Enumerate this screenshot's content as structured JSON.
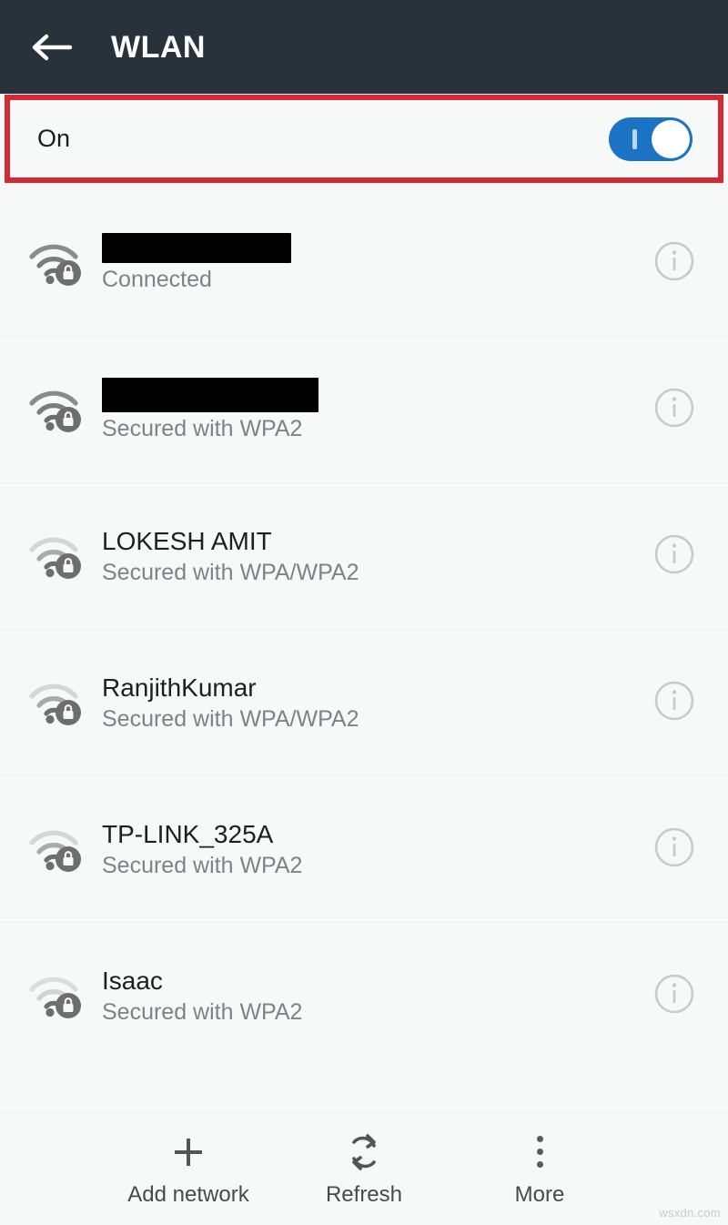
{
  "header": {
    "title": "WLAN",
    "back_icon": "arrow-left-icon",
    "background_color": "#28323a"
  },
  "wifi_switch_row": {
    "label": "On",
    "enabled": true,
    "highlight_color": "#d42a36",
    "toggle_color": "#1a73c4"
  },
  "networks": [
    {
      "ssid": "",
      "redacted": true,
      "redact_width": "w1",
      "status": "Connected",
      "icon": "wifi-lock-icon",
      "signal": 3,
      "info_icon": "info-circle-icon"
    },
    {
      "ssid": "",
      "redacted": true,
      "redact_width": "w2",
      "status": "Secured with WPA2",
      "icon": "wifi-lock-icon",
      "signal": 3,
      "info_icon": "info-circle-icon"
    },
    {
      "ssid": "LOKESH AMIT",
      "redacted": false,
      "redact_width": "",
      "status": "Secured with WPA/WPA2",
      "icon": "wifi-lock-icon",
      "signal": 2,
      "info_icon": "info-circle-icon"
    },
    {
      "ssid": "RanjithKumar",
      "redacted": false,
      "redact_width": "",
      "status": "Secured with WPA/WPA2",
      "icon": "wifi-lock-icon",
      "signal": 2,
      "info_icon": "info-circle-icon"
    },
    {
      "ssid": "TP-LINK_325A",
      "redacted": false,
      "redact_width": "",
      "status": "Secured with WPA2",
      "icon": "wifi-lock-icon",
      "signal": 2,
      "info_icon": "info-circle-icon"
    },
    {
      "ssid": "Isaac",
      "redacted": false,
      "redact_width": "",
      "status": "Secured with WPA2",
      "icon": "wifi-lock-icon",
      "signal": 1,
      "info_icon": "info-circle-icon"
    }
  ],
  "bottom_bar": {
    "items": [
      {
        "label": "Add network",
        "icon": "plus-icon"
      },
      {
        "label": "Refresh",
        "icon": "refresh-icon"
      },
      {
        "label": "More",
        "icon": "overflow-menu-icon"
      }
    ]
  },
  "watermark": {
    "text": "wsxdn.com"
  }
}
